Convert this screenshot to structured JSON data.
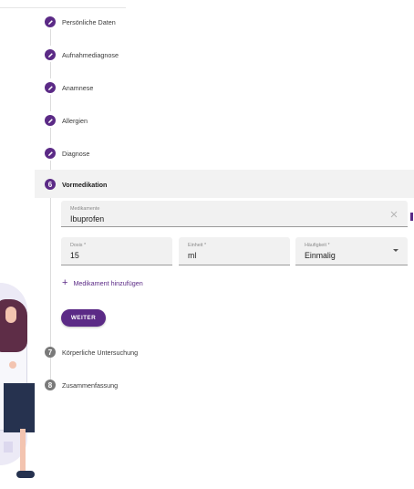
{
  "steps": [
    {
      "number": "1",
      "label": "Persönliche Daten",
      "state": "done"
    },
    {
      "number": "2",
      "label": "Aufnahmediagnose",
      "state": "done"
    },
    {
      "number": "3",
      "label": "Anamnese",
      "state": "done"
    },
    {
      "number": "4",
      "label": "Allergien",
      "state": "done"
    },
    {
      "number": "5",
      "label": "Diagnose",
      "state": "done"
    },
    {
      "number": "6",
      "label": "Vormedikation",
      "state": "active"
    },
    {
      "number": "7",
      "label": "Körperliche Untersuchung",
      "state": "pending"
    },
    {
      "number": "8",
      "label": "Zusammenfassung",
      "state": "pending"
    }
  ],
  "medication": {
    "name_label": "Medikamente",
    "name_value": "Ibuprofen",
    "dose_label": "Dosis *",
    "dose_value": "15",
    "unit_label": "Einheit *",
    "unit_value": "ml",
    "frequency_label": "Häufigkeit *",
    "frequency_value": "Einmalig"
  },
  "actions": {
    "add_medication": "Medikament hinzufügen",
    "next": "WEITER"
  },
  "colors": {
    "accent": "#5b2a86",
    "pending": "#7a7a7a",
    "field_bg": "#f1f1f1"
  },
  "icons": {
    "done_step": "pencil-icon",
    "clear": "close-icon",
    "add": "plus-icon",
    "dropdown": "chevron-down-icon"
  }
}
